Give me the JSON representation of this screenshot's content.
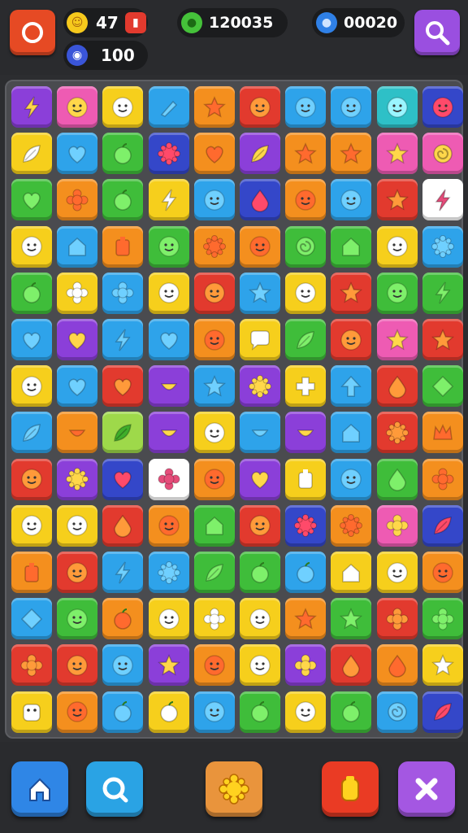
{
  "hud": {
    "coins_value": "47",
    "gems_value": "100",
    "score_value": "120035",
    "moves_value": "00020"
  },
  "colors": {
    "purple": "#8b3fd9",
    "pink": "#ee5bb3",
    "yellow": "#f6cf1c",
    "blue": "#2ea3ea",
    "orange": "#f48f1e",
    "red": "#e23a2e",
    "green": "#3fbd3a",
    "navy": "#3447c9",
    "lime": "#9ed94a",
    "teal": "#2ec0c7",
    "white": "#ffffff"
  },
  "board": {
    "columns": 10,
    "rows": 14,
    "tiles": [
      [
        "purple:bolt",
        "pink:face",
        "yellow:face",
        "blue:pick",
        "orange:star",
        "red:face",
        "blue:face",
        "blue:face",
        "teal:face",
        "navy:face"
      ],
      [
        "yellow:leaf",
        "blue:heart",
        "green:apple",
        "navy:gear",
        "orange:heart",
        "purple:leaf",
        "orange:star",
        "orange:star",
        "pink:star",
        "pink:swirl"
      ],
      [
        "green:heart",
        "orange:flower",
        "green:apple",
        "yellow:bolt",
        "blue:face",
        "navy:drop",
        "orange:face",
        "blue:face",
        "red:star",
        "white:bolt"
      ],
      [
        "yellow:face",
        "blue:house",
        "orange:block",
        "green:face",
        "orange:gear",
        "orange:face",
        "green:swirl",
        "green:house",
        "yellow:face",
        "blue:gear"
      ],
      [
        "green:apple",
        "yellow:flower",
        "blue:flower",
        "yellow:face",
        "red:face",
        "blue:star",
        "yellow:face",
        "red:star",
        "green:face",
        "green:bolt"
      ],
      [
        "blue:heart",
        "purple:heart",
        "blue:bolt",
        "blue:heart",
        "orange:face",
        "yellow:chat",
        "green:leaf",
        "red:face",
        "pink:star",
        "red:star"
      ],
      [
        "yellow:face",
        "blue:heart",
        "red:heart",
        "purple:smile",
        "blue:star",
        "purple:gear",
        "yellow:plus",
        "blue:arrow",
        "red:drop",
        "green:diamond"
      ],
      [
        "blue:leaf",
        "orange:smile",
        "lime:leaf",
        "purple:smile",
        "yellow:face",
        "blue:smile",
        "purple:smile",
        "blue:house",
        "red:gear",
        "orange:crown"
      ],
      [
        "red:face",
        "purple:gear",
        "navy:heart",
        "white:flower",
        "orange:face",
        "purple:heart",
        "yellow:block",
        "blue:face",
        "green:drop",
        "orange:flower"
      ],
      [
        "yellow:face",
        "yellow:face",
        "red:drop",
        "orange:face",
        "green:house",
        "red:face",
        "navy:gear",
        "orange:gear",
        "pink:flower",
        "navy:leaf"
      ],
      [
        "orange:block",
        "red:face",
        "blue:bolt",
        "blue:gear",
        "green:leaf",
        "green:apple",
        "blue:apple",
        "yellow:house",
        "yellow:face",
        "orange:face"
      ],
      [
        "blue:diamond",
        "green:face",
        "orange:apple",
        "yellow:face",
        "yellow:flower",
        "yellow:face",
        "orange:star",
        "green:star",
        "red:flower",
        "green:flower"
      ],
      [
        "red:flower",
        "red:face",
        "blue:face",
        "purple:star",
        "orange:face",
        "yellow:face",
        "purple:flower",
        "red:drop",
        "orange:drop",
        "yellow:star"
      ],
      [
        "yellow:cookie",
        "orange:face",
        "blue:apple",
        "yellow:apple",
        "blue:face",
        "green:apple",
        "yellow:face",
        "green:apple",
        "blue:swirl",
        "navy:leaf"
      ]
    ]
  }
}
